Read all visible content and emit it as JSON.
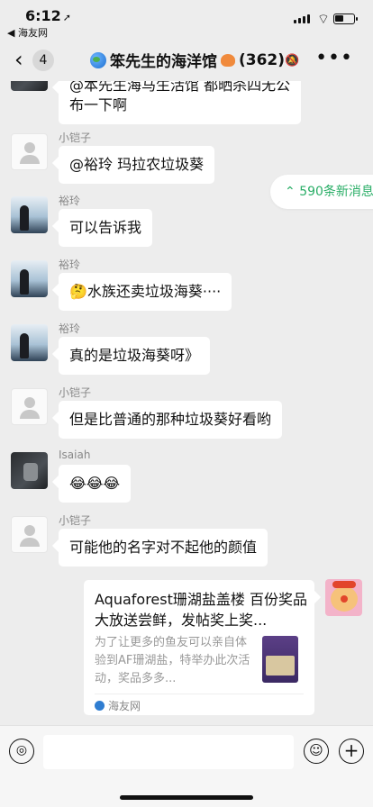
{
  "status": {
    "time": "6:12",
    "back_app": "◀ 海友网"
  },
  "nav": {
    "back_count": "4",
    "title": "笨先生的海洋馆",
    "member_count": "(362)"
  },
  "new_messages": "590条新消息",
  "messages": [
    {
      "sender": "",
      "lines": [
        "@本先生海马生活馆 都晒杀四无公",
        "布一下啊"
      ]
    },
    {
      "sender": "小铠子",
      "text": "@裕玲 玛拉农垃圾葵"
    },
    {
      "sender": "裕玲",
      "text": "可以告诉我"
    },
    {
      "sender": "裕玲",
      "text": "🤔水族还卖垃圾海葵····"
    },
    {
      "sender": "裕玲",
      "text": "真的是垃圾海葵呀》"
    },
    {
      "sender": "小铠子",
      "text": "但是比普通的那种垃圾葵好看哟"
    },
    {
      "sender": "Isaiah",
      "text": "😂😂😂"
    },
    {
      "sender": "小铠子",
      "text": "可能他的名字对不起他的颜值"
    }
  ],
  "link_card": {
    "title": "Aquaforest珊湖盐盖楼 百份奖品大放送尝鲜，发帖奖上奖...",
    "description": "为了让更多的鱼友可以亲自体验到AF珊湖盐，特举办此次活动，奖品多多...",
    "source": "海友网"
  },
  "input": {
    "placeholder": ""
  }
}
